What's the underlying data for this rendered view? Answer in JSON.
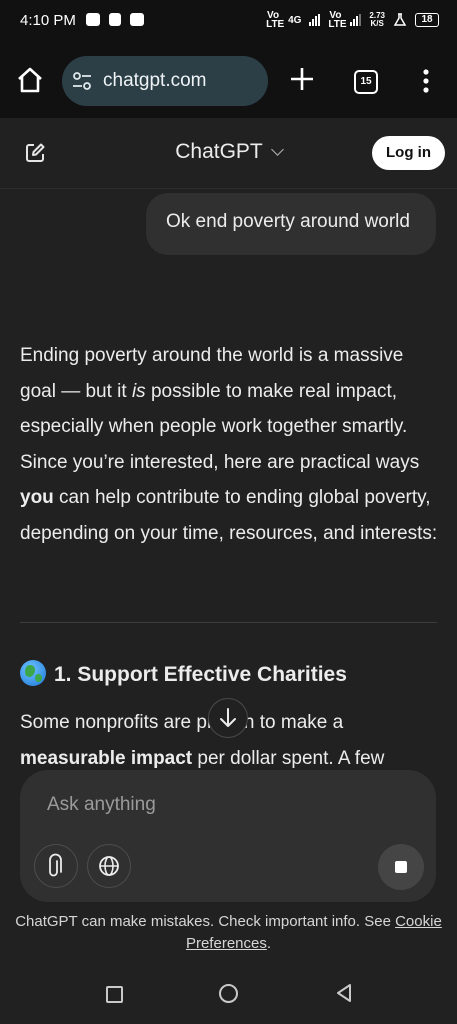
{
  "status_bar": {
    "time": "4:10 PM",
    "net1": "Vo LTE",
    "net1_gen": "4G",
    "net2": "Vo LTE",
    "speed_value": "2.73",
    "speed_unit": "K/S",
    "battery": "18"
  },
  "browser": {
    "url": "chatgpt.com",
    "tab_count": "15"
  },
  "header": {
    "title": "ChatGPT",
    "login_label": "Log in"
  },
  "conversation": {
    "user_message": "Ok end poverty around world",
    "assistant_intro_1": "Ending poverty around the world is a massive goal — but it ",
    "assistant_intro_em": "is",
    "assistant_intro_2": " possible to make real impact, especially when people work together smartly. Since you’re interested, here are practical ways ",
    "assistant_intro_bold": "you",
    "assistant_intro_3": " can help contribute to ending global poverty, depending on your time, resources, and interests:",
    "section_heading": "1. Support Effective Charities",
    "section_text_1": "Some nonprofits are proven to make a ",
    "section_text_bold": "measurable impact",
    "section_text_2": " per dollar spent. A few"
  },
  "composer": {
    "placeholder": "Ask anything"
  },
  "disclaimer": {
    "text": "ChatGPT can make mistakes. Check important info. See ",
    "link1": "Cookie",
    "link2": "Preferences",
    "end": "."
  },
  "icons": {
    "home": "home-icon",
    "url_tune": "tune-icon",
    "new_tab": "plus-icon",
    "menu": "more-vert-icon",
    "compose": "edit-icon",
    "scroll_down": "arrow-down-icon",
    "attach": "paperclip-icon",
    "web": "globe-icon",
    "stop": "stop-icon"
  }
}
